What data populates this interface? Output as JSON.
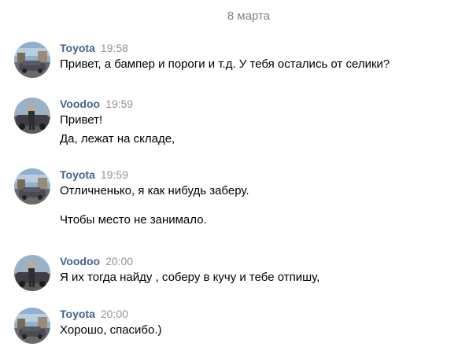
{
  "date_separator": "8 марта",
  "messages": [
    {
      "author": "Toyota",
      "time": "19:58",
      "avatar_icon": "car-street-avatar",
      "lines": [
        "Привет, а бампер и пороги и т.д. У тебя остались от селики?"
      ]
    },
    {
      "author": "Voodoo",
      "time": "19:59",
      "avatar_icon": "person-car-avatar",
      "lines": [
        "Привет!",
        "Да, лежат на складе,"
      ]
    },
    {
      "author": "Toyota",
      "time": "19:59",
      "avatar_icon": "car-street-avatar",
      "lines": [
        "Отличненько, я как нибудь заберу.",
        "Чтобы место не занимало."
      ]
    },
    {
      "author": "Voodoo",
      "time": "20:00",
      "avatar_icon": "person-car-avatar",
      "lines": [
        "Я их тогда найду , соберу в кучу и тебе отпишу,"
      ]
    },
    {
      "author": "Toyota",
      "time": "20:00",
      "avatar_icon": "car-street-avatar",
      "lines": [
        "Хорошо, спасибо.)"
      ]
    }
  ],
  "colors": {
    "author": "#42648b",
    "time": "#939393",
    "date": "#828282",
    "text": "#000000"
  }
}
